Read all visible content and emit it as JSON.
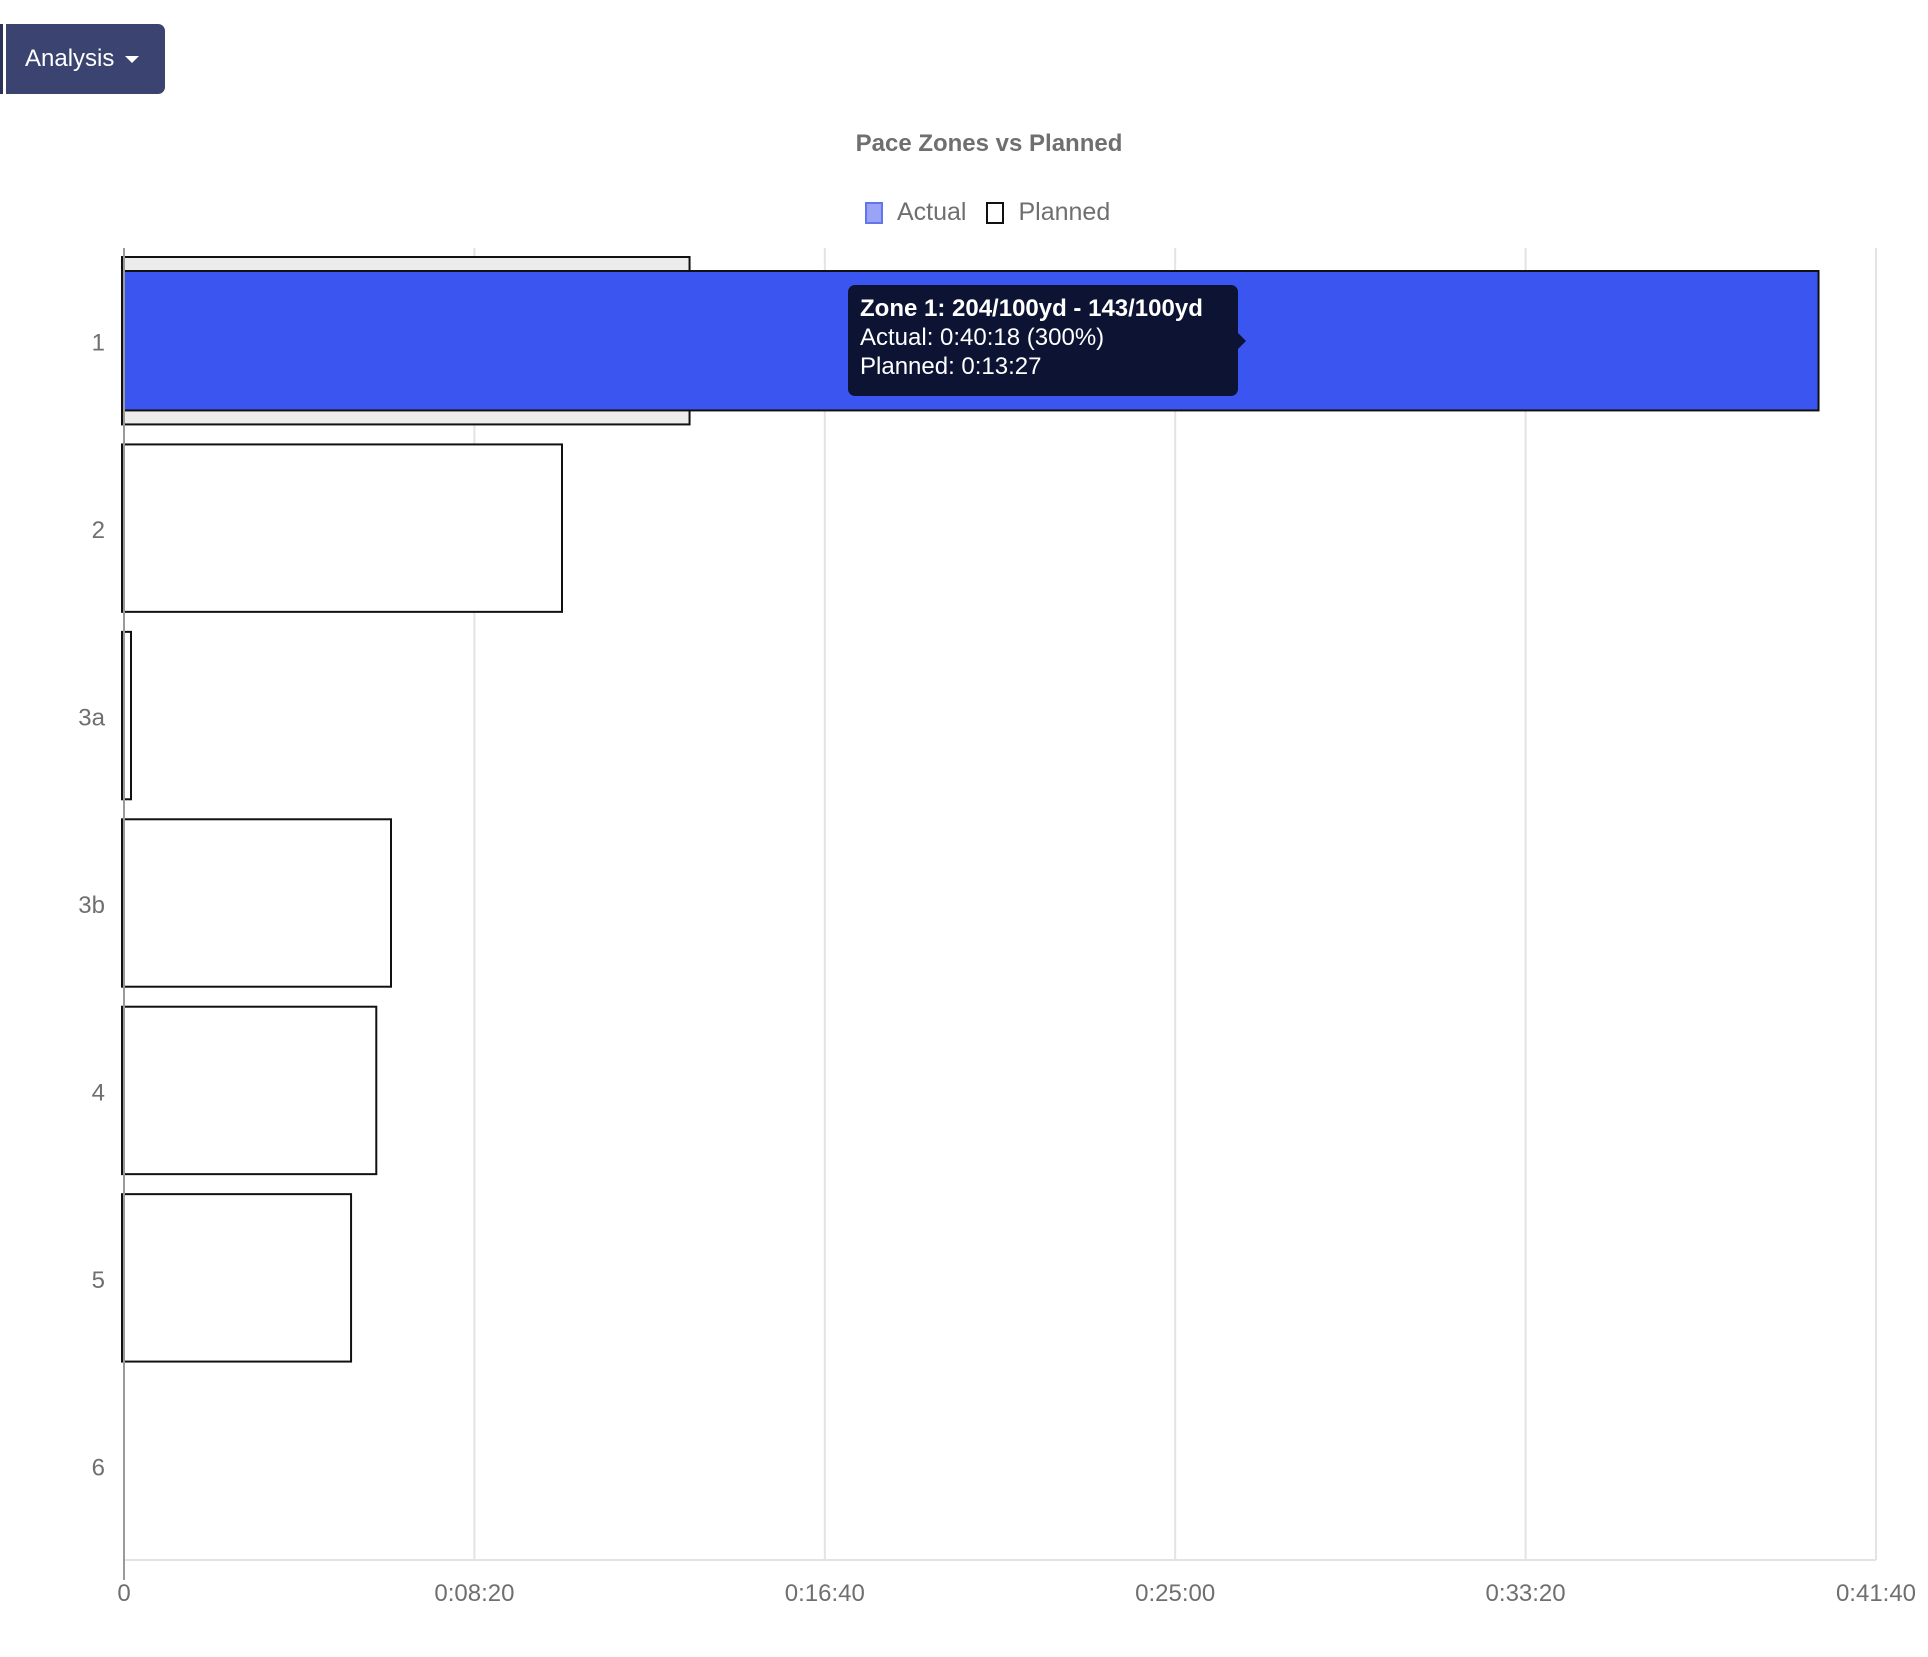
{
  "toolbar": {
    "analysis_label": "Analysis"
  },
  "colors": {
    "actual": "#3b55f0",
    "actual_legend": "#9aa4f7",
    "planned_hover": "#ececec",
    "tooltip_bg": "#0d1433"
  },
  "chart_data": {
    "type": "bar",
    "orientation": "horizontal",
    "title": "Pace Zones vs Planned",
    "legend_position": "top-center",
    "grid": true,
    "categories": [
      "1",
      "2",
      "3a",
      "3b",
      "4",
      "5",
      "6"
    ],
    "series": [
      {
        "name": "Actual",
        "values": [
          2418,
          0,
          0,
          0,
          0,
          0,
          0
        ]
      },
      {
        "name": "Planned",
        "values": [
          807,
          625,
          10,
          381,
          360,
          324,
          0
        ]
      }
    ],
    "xlim": [
      0,
      2500
    ],
    "x_ticks": [
      0,
      500,
      1000,
      1500,
      2000,
      2500
    ],
    "x_tick_labels": [
      "0",
      "0:08:20",
      "0:16:40",
      "0:25:00",
      "0:33:20",
      "0:41:40"
    ],
    "x_unit": "seconds",
    "tooltip": {
      "title": "Zone 1: 204/100yd - 143/100yd",
      "actual": "Actual: 0:40:18 (300%)",
      "planned": "Planned: 0:13:27"
    }
  }
}
